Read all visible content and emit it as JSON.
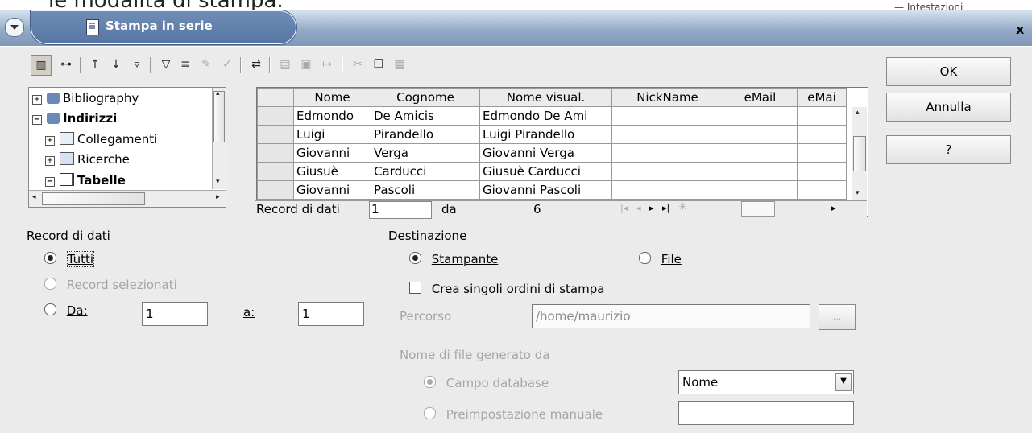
{
  "background": {
    "doc_text": "le modalità di stampa.",
    "right_text": "— Intestazioni"
  },
  "window": {
    "title": "Stampa in serie",
    "close_glyph": "x"
  },
  "buttons": {
    "ok": "OK",
    "cancel": "Annulla",
    "help": "?"
  },
  "tree": {
    "items": [
      {
        "label": "Bibliography",
        "bold": false
      },
      {
        "label": "Indirizzi",
        "bold": true
      },
      {
        "label": "Collegamenti",
        "bold": false
      },
      {
        "label": "Ricerche",
        "bold": false
      },
      {
        "label": "Tabelle",
        "bold": true
      }
    ]
  },
  "grid": {
    "columns": [
      "Nome",
      "Cognome",
      "Nome visual.",
      "NickName",
      "eMail",
      "eMai"
    ],
    "rows": [
      [
        "Edmondo",
        "De Amicis",
        "Edmondo De Ami",
        "",
        ""
      ],
      [
        "Luigi",
        "Pirandello",
        "Luigi Pirandello",
        "",
        ""
      ],
      [
        "Giovanni",
        "Verga",
        "Giovanni Verga",
        "",
        ""
      ],
      [
        "Giusuè",
        "Carducci",
        "Giusuè Carducci",
        "",
        ""
      ],
      [
        "Giovanni",
        "Pascoli",
        "Giovanni Pascoli",
        "",
        ""
      ]
    ],
    "nav_label": "Record di dati",
    "nav_value": "1",
    "nav_of": "da",
    "nav_total": "6"
  },
  "records": {
    "heading": "Record di dati",
    "all": "Tutti",
    "selected": "Record selezionati",
    "from": "Da:",
    "from_value": "1",
    "to": "a:",
    "to_value": "1"
  },
  "destination": {
    "heading": "Destinazione",
    "printer": "Stampante",
    "file": "File",
    "single_jobs": "Crea singoli ordini di stampa",
    "path_label": "Percorso",
    "path_value": "/home/maurizio",
    "browse": "...",
    "filename_heading": "Nome di file generato da",
    "db_field": "Campo database",
    "db_field_value": "Nome",
    "manual": "Preimpostazione manuale",
    "manual_value": ""
  }
}
